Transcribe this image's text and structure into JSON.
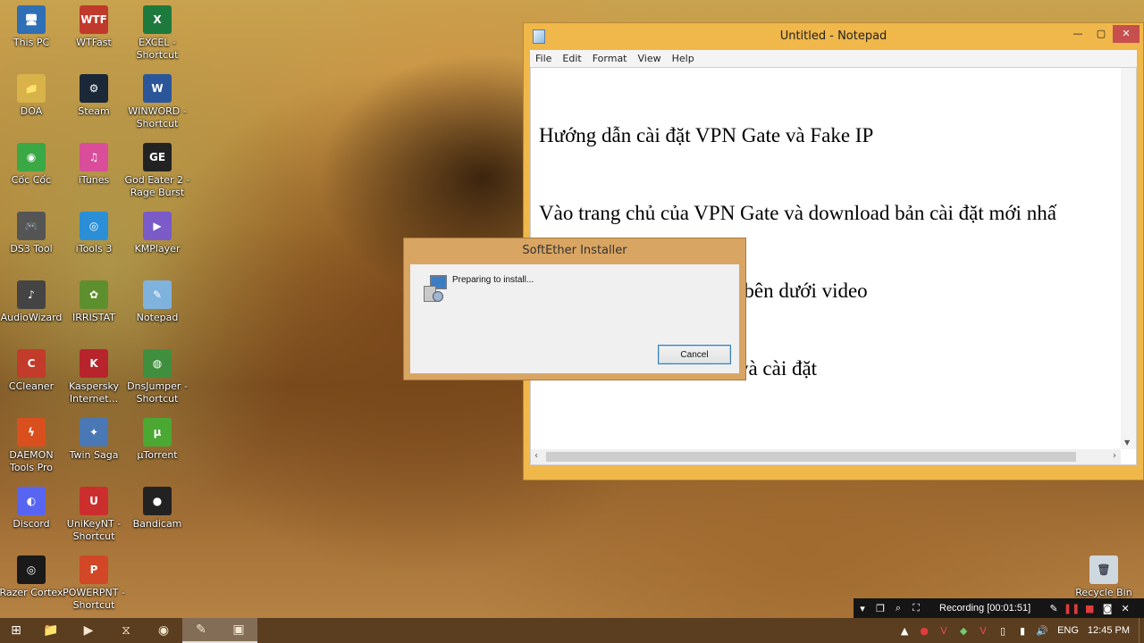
{
  "desktop_icons": [
    {
      "label": "This PC",
      "glyph": "🖥",
      "bg": "#2e6fb5"
    },
    {
      "label": "WTFast",
      "glyph": "WTF",
      "bg": "#c0392b"
    },
    {
      "label": "EXCEL -\nShortcut",
      "glyph": "X",
      "bg": "#1e7a3c"
    },
    {
      "label": "DOA",
      "glyph": "📁",
      "bg": "#d8b34a"
    },
    {
      "label": "Steam",
      "glyph": "⚙",
      "bg": "#1b2838"
    },
    {
      "label": "WINWORD -\nShortcut",
      "glyph": "W",
      "bg": "#2b579a"
    },
    {
      "label": "Cốc Cốc",
      "glyph": "◉",
      "bg": "#3aa845"
    },
    {
      "label": "iTunes",
      "glyph": "♫",
      "bg": "#d94d9a"
    },
    {
      "label": "God Eater 2 -\nRage Burst",
      "glyph": "GE",
      "bg": "#222222"
    },
    {
      "label": "DS3 Tool",
      "glyph": "🎮",
      "bg": "#555555"
    },
    {
      "label": "iTools 3",
      "glyph": "◎",
      "bg": "#2a8fd6"
    },
    {
      "label": "KMPlayer",
      "glyph": "▶",
      "bg": "#7a5bc7"
    },
    {
      "label": "AudioWizard",
      "glyph": "♪",
      "bg": "#444444"
    },
    {
      "label": "IRRISTAT",
      "glyph": "✿",
      "bg": "#5e8f2e"
    },
    {
      "label": "Notepad",
      "glyph": "✎",
      "bg": "#7fb3de"
    },
    {
      "label": "CCleaner",
      "glyph": "C",
      "bg": "#c23b2b"
    },
    {
      "label": "Kaspersky\nInternet...",
      "glyph": "K",
      "bg": "#b8242c"
    },
    {
      "label": "DnsJumper -\nShortcut",
      "glyph": "◍",
      "bg": "#3f8f3f"
    },
    {
      "label": "DAEMON\nTools Pro",
      "glyph": "ϟ",
      "bg": "#d9501e"
    },
    {
      "label": "Twin Saga",
      "glyph": "✦",
      "bg": "#4a78b5"
    },
    {
      "label": "µTorrent",
      "glyph": "µ",
      "bg": "#4aa833"
    },
    {
      "label": "Discord",
      "glyph": "◐",
      "bg": "#5865f2"
    },
    {
      "label": "UniKeyNT -\nShortcut",
      "glyph": "U",
      "bg": "#cc2e2e"
    },
    {
      "label": "Bandicam",
      "glyph": "●",
      "bg": "#222222"
    },
    {
      "label": "Razer Cortex",
      "glyph": "◎",
      "bg": "#1a1a1a"
    },
    {
      "label": "POWERPNT -\nShortcut",
      "glyph": "P",
      "bg": "#d24726"
    }
  ],
  "recycle_bin": {
    "label": "Recycle Bin",
    "glyph": "🗑"
  },
  "notepad": {
    "title": "Untitled - Notepad",
    "menu": [
      "File",
      "Edit",
      "Format",
      "View",
      "Help"
    ],
    "lines": [
      "Hướng dẫn cài đặt VPN Gate và Fake IP",
      "Vào trang chủ của VPN Gate và download bản cài đặt mới nhấ",
      "Link down mình sẽ để ở bên dưới video",
      "Down xong thì giải nén và cài đặt"
    ]
  },
  "dialog": {
    "title": "SoftEther Installer",
    "message": "Preparing to install...",
    "cancel_label": "Cancel"
  },
  "recording": {
    "text": "Recording [00:01:51]"
  },
  "taskbar": {
    "items": [
      {
        "name": "file-explorer",
        "glyph": "📁"
      },
      {
        "name": "media-player",
        "glyph": "▶"
      },
      {
        "name": "kmplayer",
        "glyph": "⧖"
      },
      {
        "name": "coc-coc",
        "glyph": "◉"
      },
      {
        "name": "notepad",
        "glyph": "✎"
      },
      {
        "name": "softether-installer",
        "glyph": "▣"
      }
    ],
    "language": "ENG",
    "time": "12:45 PM"
  },
  "colors": {
    "window_accent": "#f0b74b",
    "dialog_accent": "#d9a563",
    "taskbar": "#5b3d1f"
  }
}
